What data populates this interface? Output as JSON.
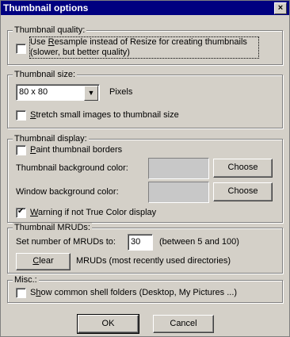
{
  "window": {
    "title": "Thumbnail options",
    "close_glyph": "×"
  },
  "quality": {
    "legend": "Thumbnail quality:",
    "use_resample": {
      "checked": false,
      "line1_pre": "Use ",
      "line1_u": "R",
      "line1_post": "esample instead of Resize for creating thumbnails",
      "line2": "(slower, but better quality)"
    }
  },
  "size": {
    "legend": "Thumbnail size:",
    "combo_value": "80 x 80",
    "combo_arrow": "▼",
    "unit_label": "Pixels",
    "stretch": {
      "checked": false,
      "u": "S",
      "rest": "tretch small images to thumbnail size"
    }
  },
  "display": {
    "legend": "Thumbnail display:",
    "paint_borders": {
      "checked": false,
      "u": "P",
      "rest": "aint thumbnail borders"
    },
    "thumb_bg_label": "Thumbnail background color:",
    "thumb_bg_color": "#c8c8c8",
    "window_bg_label": "Window background color:",
    "window_bg_color": "#c8c8c8",
    "choose_label": "Choose",
    "warning": {
      "checked": true,
      "u": "W",
      "rest": "arning if not True Color display"
    }
  },
  "mruds": {
    "legend": "Thumbnail MRUDs:",
    "set_label": "Set number of MRUDs to:",
    "value": "30",
    "range_text": "(between 5 and 100)",
    "clear_u": "C",
    "clear_rest": "lear",
    "clear_desc": "MRUDs (most recently used directories)"
  },
  "misc": {
    "legend": "Misc.:",
    "show_shell": {
      "checked": false,
      "u_pre": "S",
      "u": "h",
      "rest": "ow common shell folders (Desktop, My Pictures ...)"
    }
  },
  "footer": {
    "ok_label": "OK",
    "cancel_label": "Cancel"
  }
}
